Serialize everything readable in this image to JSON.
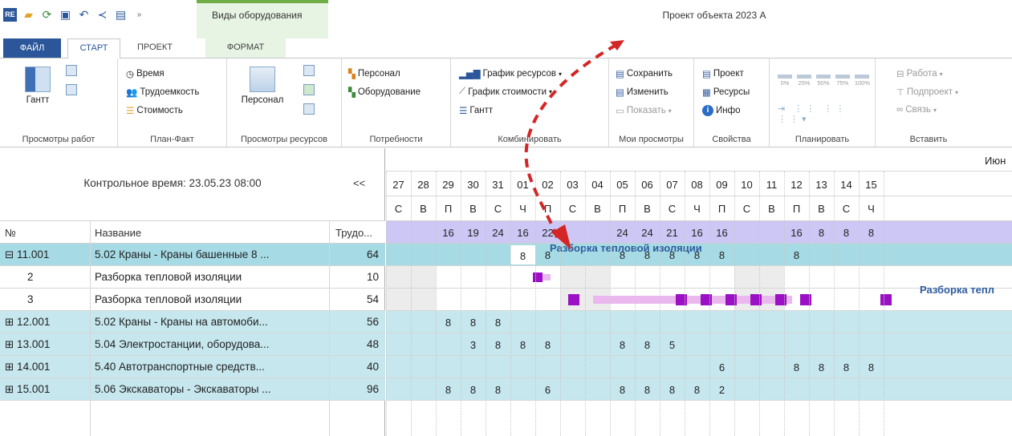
{
  "title_bar": {
    "window_title": "Проект объекта 2023 А",
    "context_group_label": "Виды оборудования"
  },
  "tabs": {
    "file": "ФАЙЛ",
    "start": "СТАРТ",
    "project": "ПРОЕКТ",
    "format": "ФОРМАТ"
  },
  "ribbon": {
    "work_views": {
      "gantt": "Гантт",
      "caption": "Просмотры работ"
    },
    "plan_fact": {
      "time": "Время",
      "labor": "Трудоемкость",
      "cost": "Стоимость",
      "caption": "План-Факт"
    },
    "resource_views": {
      "personnel": "Персонал",
      "caption": "Просмотры ресурсов"
    },
    "needs": {
      "personnel": "Персонал",
      "equipment": "Оборудование",
      "caption": "Потребности"
    },
    "combine": {
      "resource_chart": "График ресурсов",
      "cost_chart": "График стоимости",
      "gantt": "Гантт",
      "caption": "Комбинировать"
    },
    "my_views": {
      "save": "Сохранить",
      "edit": "Изменить",
      "show": "Показать",
      "caption": "Мои просмотры"
    },
    "properties": {
      "project": "Проект",
      "resources": "Ресурсы",
      "info": "Инфо",
      "caption": "Свойства"
    },
    "planning": {
      "pcts": [
        "0%",
        "25%",
        "50%",
        "75%",
        "100%"
      ],
      "caption": "Планировать"
    },
    "insert": {
      "work": "Работа",
      "subproject": "Подпроект",
      "link": "Связь",
      "caption": "Вставить"
    }
  },
  "left": {
    "control_time": "Контрольное время: 23.05.23 08:00",
    "collapse": "<<",
    "col_num": "№",
    "col_name": "Название",
    "col_labor": "Трудо...",
    "rows": [
      {
        "num": "⊟ 11.001",
        "name": "5.02 Краны - Краны башенные 8 ...",
        "labor": "64"
      },
      {
        "num": "2",
        "name": "Разборка тепловой изоляции",
        "labor": "10"
      },
      {
        "num": "3",
        "name": "Разборка тепловой изоляции",
        "labor": "54"
      },
      {
        "num": "⊞ 12.001",
        "name": "5.02 Краны - Краны на автомоби...",
        "labor": "56"
      },
      {
        "num": "⊞ 13.001",
        "name": "5.04 Электростанции, оборудова...",
        "labor": "48"
      },
      {
        "num": "⊞ 14.001",
        "name": "5.40 Автотранспортные средств...",
        "labor": "40"
      },
      {
        "num": "⊞ 15.001",
        "name": "5.06 Экскаваторы - Экскаваторы ...",
        "labor": "96"
      }
    ]
  },
  "gantt": {
    "month": "Июн",
    "days": [
      "27",
      "28",
      "29",
      "30",
      "31",
      "01",
      "02",
      "03",
      "04",
      "05",
      "06",
      "07",
      "08",
      "09",
      "10",
      "11",
      "12",
      "13",
      "14",
      "15"
    ],
    "weekdays": [
      "С",
      "В",
      "П",
      "В",
      "С",
      "Ч",
      "П",
      "С",
      "В",
      "П",
      "В",
      "С",
      "Ч",
      "П",
      "С",
      "В",
      "П",
      "В",
      "С",
      "Ч"
    ],
    "totals": [
      "",
      "",
      "16",
      "19",
      "24",
      "16",
      "22",
      "",
      "",
      "24",
      "24",
      "21",
      "16",
      "16",
      "",
      "",
      "16",
      "8",
      "8",
      "8"
    ],
    "row_values": [
      [
        "",
        "",
        "",
        "",
        "",
        "8",
        "8",
        "",
        "",
        "8",
        "8",
        "8",
        "8",
        "8",
        "",
        "",
        "8",
        "",
        "",
        ""
      ],
      [
        "",
        "",
        "",
        "",
        "",
        "",
        "",
        "",
        "",
        "",
        "",
        "",
        "",
        "",
        "",
        "",
        "",
        "",
        "",
        ""
      ],
      [
        "",
        "",
        "",
        "",
        "",
        "",
        "",
        "",
        "",
        "",
        "",
        "",
        "",
        "",
        "",
        "",
        "",
        "",
        "",
        ""
      ],
      [
        "",
        "",
        "8",
        "8",
        "8",
        "",
        "",
        "",
        "",
        "",
        "",
        "",
        "",
        "",
        "",
        "",
        "",
        "",
        "",
        ""
      ],
      [
        "",
        "",
        "",
        "3",
        "8",
        "8",
        "8",
        "",
        "",
        "8",
        "8",
        "5",
        "",
        "",
        "",
        "",
        "",
        "",
        "",
        ""
      ],
      [
        "",
        "",
        "",
        "",
        "",
        "",
        "",
        "",
        "",
        "",
        "",
        "",
        "",
        "6",
        "",
        "",
        "8",
        "8",
        "8",
        "8"
      ],
      [
        "",
        "",
        "8",
        "8",
        "8",
        "",
        "6",
        "",
        "",
        "8",
        "8",
        "8",
        "8",
        "2",
        "",
        "",
        "",
        "",
        "",
        ""
      ]
    ],
    "bar_label_1": "Разборка тепловой изоляции",
    "bar_label_2": "Разборка тепл"
  },
  "colors": {
    "teal": "#c6e7ee",
    "teal_selected": "#a6dbe5",
    "header_lilac": "#ccc7f5",
    "bar_purple": "#9b10c4",
    "bar_pink": "#eab8ef",
    "arrow_red": "#d42626",
    "label_blue": "#2e5c9e"
  }
}
